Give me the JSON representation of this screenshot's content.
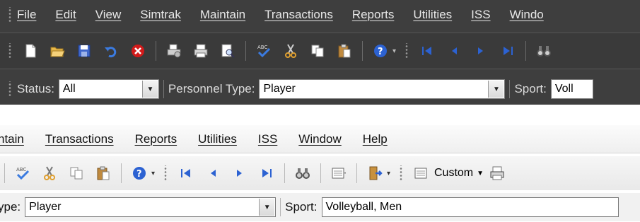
{
  "top_menu": [
    "File",
    "Edit",
    "View",
    "Simtrak",
    "Maintain",
    "Transactions",
    "Reports",
    "Utilities",
    "ISS",
    "Windo"
  ],
  "top_filters": {
    "status_label": "Status:",
    "status_value": "All",
    "personnel_label": "Personnel Type:",
    "personnel_value": "Player",
    "sport_label": "Sport:",
    "sport_value": "Voll"
  },
  "bottom_menu": [
    "ntain",
    "Transactions",
    "Reports",
    "Utilities",
    "ISS",
    "Window",
    "Help"
  ],
  "bottom_toolbar": {
    "custom_label": "Custom"
  },
  "bottom_filters": {
    "personnel_label": "ype:",
    "personnel_value": "Player",
    "sport_label": "Sport:",
    "sport_value": "Volleyball, Men"
  },
  "icons": {
    "top_toolbar": [
      "new-document-icon",
      "open-folder-icon",
      "save-icon",
      "undo-icon",
      "cancel-icon",
      "print-setup-icon",
      "print-icon",
      "print-preview-icon",
      "spell-check-icon",
      "cut-icon",
      "copy-icon",
      "paste-icon",
      "help-icon",
      "first-record-icon",
      "previous-record-icon",
      "next-record-icon",
      "last-record-icon",
      "find-icon"
    ],
    "bottom_toolbar": [
      "spell-check-icon",
      "cut-icon",
      "copy-icon",
      "paste-icon",
      "help-icon",
      "first-record-icon",
      "previous-record-icon",
      "next-record-icon",
      "last-record-icon",
      "find-icon",
      "view-list-icon",
      "exit-door-icon",
      "custom-list-icon",
      "custom-print-icon"
    ]
  },
  "colors": {
    "dark_chrome": "#3e3e3e",
    "light_chrome": "#f1f1f1",
    "nav_blue": "#2c62d2",
    "cancel_red": "#d21a1a"
  }
}
